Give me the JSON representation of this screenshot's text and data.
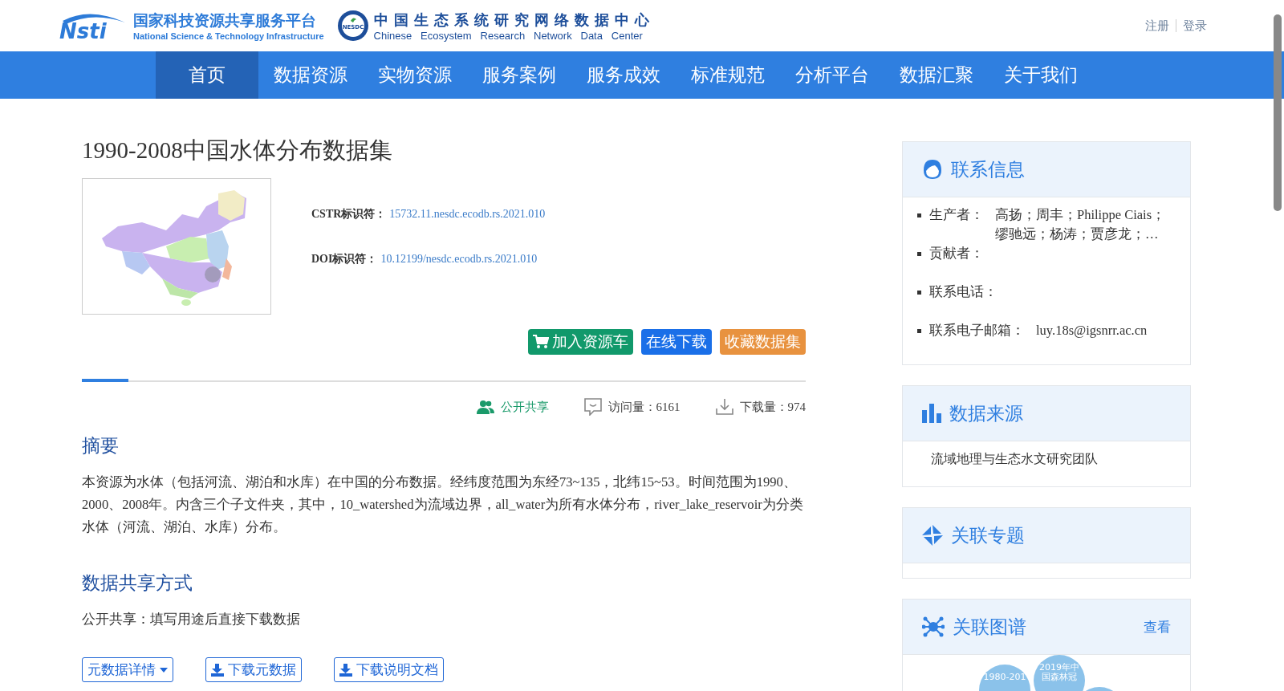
{
  "header": {
    "logo_mark": "Nsti",
    "platform_name": "国家科技资源共享服务平台",
    "platform_name_en": "National Science & Technology Infrastructure",
    "badge_text": "NESDC",
    "center_name": "中国生态系统研究网络数据中心",
    "center_name_en": [
      "Chinese",
      "Ecosystem",
      "Research",
      "Network",
      "Data",
      "Center"
    ],
    "auth_links": [
      "注册",
      "登录"
    ]
  },
  "nav": [
    {
      "label": "首页",
      "selected": true
    },
    {
      "label": "数据资源",
      "selected": false
    },
    {
      "label": "实物资源",
      "selected": false
    },
    {
      "label": "服务案例",
      "selected": false
    },
    {
      "label": "服务成效",
      "selected": false
    },
    {
      "label": "标准规范",
      "selected": false
    },
    {
      "label": "分析平台",
      "selected": false
    },
    {
      "label": "数据汇聚",
      "selected": false
    },
    {
      "label": "关于我们",
      "selected": false
    }
  ],
  "dataset": {
    "title": "1990-2008中国水体分布数据集",
    "identifiers": [
      {
        "label": "CSTR标识符：",
        "value": "15732.11.nesdc.ecodb.rs.2021.010"
      },
      {
        "label": "DOI标识符：",
        "value": "10.12199/nesdc.ecodb.rs.2021.010"
      }
    ],
    "actions": [
      {
        "kind": "cart",
        "label": "加入资源车"
      },
      {
        "kind": "download",
        "label": "在线下载"
      },
      {
        "kind": "favorite",
        "label": "收藏数据集"
      }
    ],
    "stats": [
      {
        "kind": "share",
        "text": "公开共享"
      },
      {
        "kind": "views",
        "text": "访问量：6161"
      },
      {
        "kind": "downloads",
        "text": "下载量：974"
      }
    ],
    "abstract_title": "摘要",
    "abstract": "本资源为水体（包括河流、湖泊和水库）在中国的分布数据。经纬度范围为东经73~135，北纬15~53。时间范围为1990、2000、2008年。内含三个子文件夹，其中，10_watershed为流域边界，all_water为所有水体分布，river_lake_reservoir为分类水体（河流、湖泊、水库）分布。",
    "sharing_title": "数据共享方式",
    "sharing_text": "公开共享：填写用途后直接下载数据",
    "bottom_buttons": [
      {
        "kind": "dropdown",
        "label": "元数据详情"
      },
      {
        "kind": "download",
        "label": "下载元数据"
      },
      {
        "kind": "download",
        "label": "下载说明文档"
      }
    ]
  },
  "sidebar": {
    "contact": {
      "title": "联系信息",
      "rows": [
        {
          "label": "生产者：",
          "value": "高扬；周丰；Philippe Ciais；缪驰远；杨涛；贾彦龙；…"
        },
        {
          "label": "贡献者："
        },
        {
          "label": "联系电话："
        },
        {
          "label": "联系电子邮箱：",
          "value": "luy.18s@igsnrr.ac.cn"
        }
      ]
    },
    "source": {
      "title": "数据来源",
      "text": "流域地理与生态水文研究团队"
    },
    "topics": {
      "title": "关联专题"
    },
    "graph": {
      "title": "关联图谱",
      "link": "查看",
      "nodes": [
        {
          "kind": "bubble",
          "label": "1980-201"
        },
        {
          "kind": "bubble",
          "label": "2019年中国森林冠"
        },
        {
          "kind": "bubble"
        }
      ]
    }
  }
}
